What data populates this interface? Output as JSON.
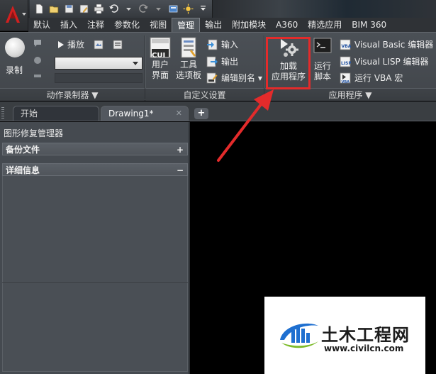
{
  "titlebar": {
    "qat_icons": [
      "new-file-icon",
      "open-icon",
      "save-icon",
      "save-as-icon",
      "plot-icon",
      "undo-icon",
      "redo-icon",
      "workspace-icon",
      "sun-icon",
      "more-icon"
    ]
  },
  "ribbon_tabs": [
    {
      "label": "默认",
      "active": false
    },
    {
      "label": "插入",
      "active": false
    },
    {
      "label": "注释",
      "active": false
    },
    {
      "label": "参数化",
      "active": false
    },
    {
      "label": "视图",
      "active": false
    },
    {
      "label": "管理",
      "active": true
    },
    {
      "label": "输出",
      "active": false
    },
    {
      "label": "附加模块",
      "active": false
    },
    {
      "label": "A360",
      "active": false
    },
    {
      "label": "精选应用",
      "active": false
    },
    {
      "label": "BIM 360",
      "active": false
    }
  ],
  "action_recorder": {
    "record_label": "录制",
    "play_label": "播放",
    "panel_title": "动作录制器 ▼"
  },
  "customization": {
    "cui_badge": "CUI",
    "user_interface_label_1": "用户",
    "user_interface_label_2": "界面",
    "tool_palettes_label_1": "工具",
    "tool_palettes_label_2": "选项板",
    "import_label": "输入",
    "export_label": "输出",
    "edit_aliases_label": "编辑别名 ▾",
    "panel_title": "自定义设置"
  },
  "applications": {
    "load_app_label_1": "加载",
    "load_app_label_2": "应用程序",
    "run_script_label_1": "运行",
    "run_script_label_2": "脚本",
    "vba_editor_label": "Visual Basic 编辑器",
    "lisp_editor_label": "Visual LISP 编辑器",
    "run_vba_label": "运行 VBA 宏",
    "panel_title": "应用程序 ▼"
  },
  "file_tabs": [
    {
      "label": "开始",
      "active": false
    },
    {
      "label": "Drawing1*",
      "active": true
    }
  ],
  "file_tab_close": "✕",
  "new_tab_symbol": "+",
  "palette": {
    "title": "图形修复管理器",
    "backup_section": "备份文件",
    "backup_symbol": "+",
    "details_section": "详细信息",
    "details_symbol": "−"
  },
  "watermark": {
    "name": "土木工程网",
    "url": "www.civilcn.com"
  },
  "colors": {
    "highlight": "#e32b2b",
    "watermark_blue": "#1e6fd0",
    "watermark_green": "#7dbb2b"
  }
}
